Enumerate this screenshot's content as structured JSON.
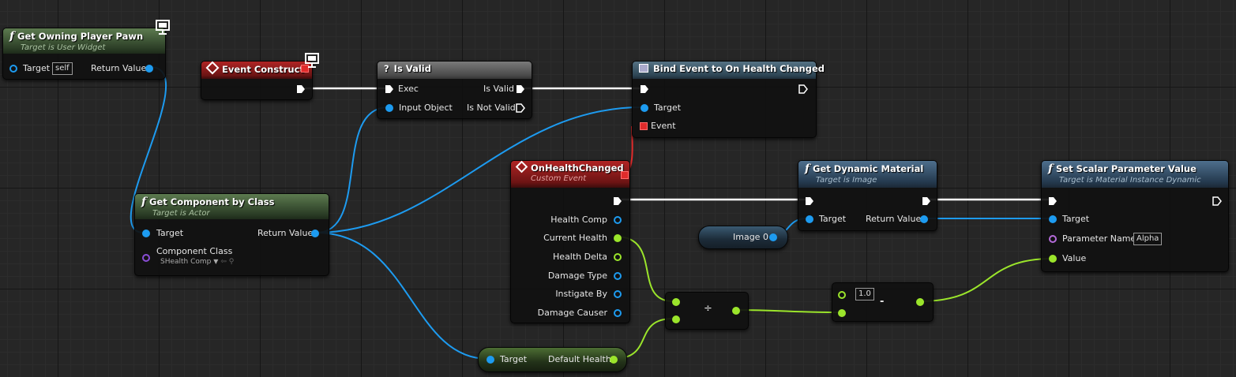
{
  "nodes": {
    "get_owning_player_pawn": {
      "title": "Get Owning Player Pawn",
      "subtitle": "Target is User Widget",
      "target": "Target",
      "target_default": "self",
      "return": "Return Value"
    },
    "event_construct": {
      "title": "Event Construct"
    },
    "is_valid": {
      "title": "Is Valid",
      "exec": "Exec",
      "input_object": "Input Object",
      "is_valid": "Is Valid",
      "is_not_valid": "Is Not Valid",
      "icon": "?"
    },
    "bind_event": {
      "title": "Bind Event to On Health Changed",
      "target": "Target",
      "event": "Event"
    },
    "get_component_by_class": {
      "title": "Get Component by Class",
      "subtitle": "Target is Actor",
      "target": "Target",
      "return": "Return Value",
      "component_class": "Component Class",
      "class_value": "SHealth Comp"
    },
    "on_health_changed": {
      "title": "OnHealthChanged",
      "subtitle": "Custom Event",
      "pins": [
        "Health Comp",
        "Current Health",
        "Health Delta",
        "Damage Type",
        "Instigate By",
        "Damage Causer"
      ]
    },
    "get_dynamic_material": {
      "title": "Get Dynamic Material",
      "subtitle": "Target is Image",
      "target": "Target",
      "return": "Return Value"
    },
    "image_var": {
      "label": "Image 0"
    },
    "set_scalar": {
      "title": "Set Scalar Parameter Value",
      "subtitle": "Target is Material Instance Dynamic",
      "target": "Target",
      "param_name": "Parameter Name",
      "param_value": "Alpha",
      "value": "Value"
    },
    "divide": {
      "symbol": "÷"
    },
    "subtract": {
      "symbol": "-",
      "constant": "1.0"
    },
    "default_health": {
      "target": "Target",
      "output": "Default Health"
    }
  },
  "colors": {
    "object_pin": "#1d9bf0",
    "float_pin": "#9be52b",
    "exec_wire": "#ffffff",
    "delegate": "#e02b2b",
    "class_pin": "#8a4dd6",
    "name_pin": "#b46bd9"
  }
}
